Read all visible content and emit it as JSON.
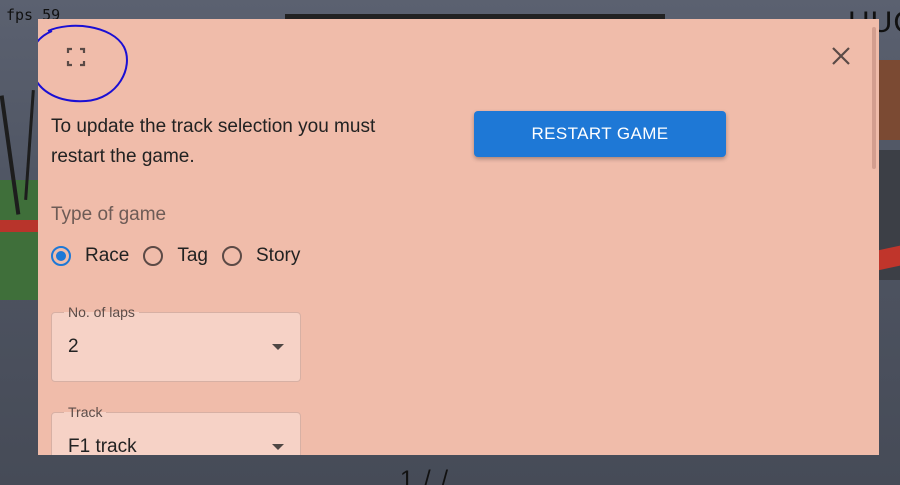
{
  "hud": {
    "fps_text": "fps 59",
    "right_text": "HUC",
    "bottom_text": "1 / /"
  },
  "dialog": {
    "info_text": "To update the track selection you must restart the game.",
    "restart_label": "RESTART GAME",
    "game_type": {
      "label": "Type of game",
      "options": [
        "Race",
        "Tag",
        "Story"
      ],
      "selected": "Race"
    },
    "laps": {
      "label": "No. of laps",
      "value": "2"
    },
    "track": {
      "label": "Track",
      "value": "F1 track"
    }
  },
  "colors": {
    "dialog_bg": "#f0bcaa",
    "accent": "#1e78d6",
    "annotation": "#1a0fd4"
  },
  "icons": [
    "fullscreen-icon",
    "close-icon",
    "chevron-down-icon"
  ]
}
